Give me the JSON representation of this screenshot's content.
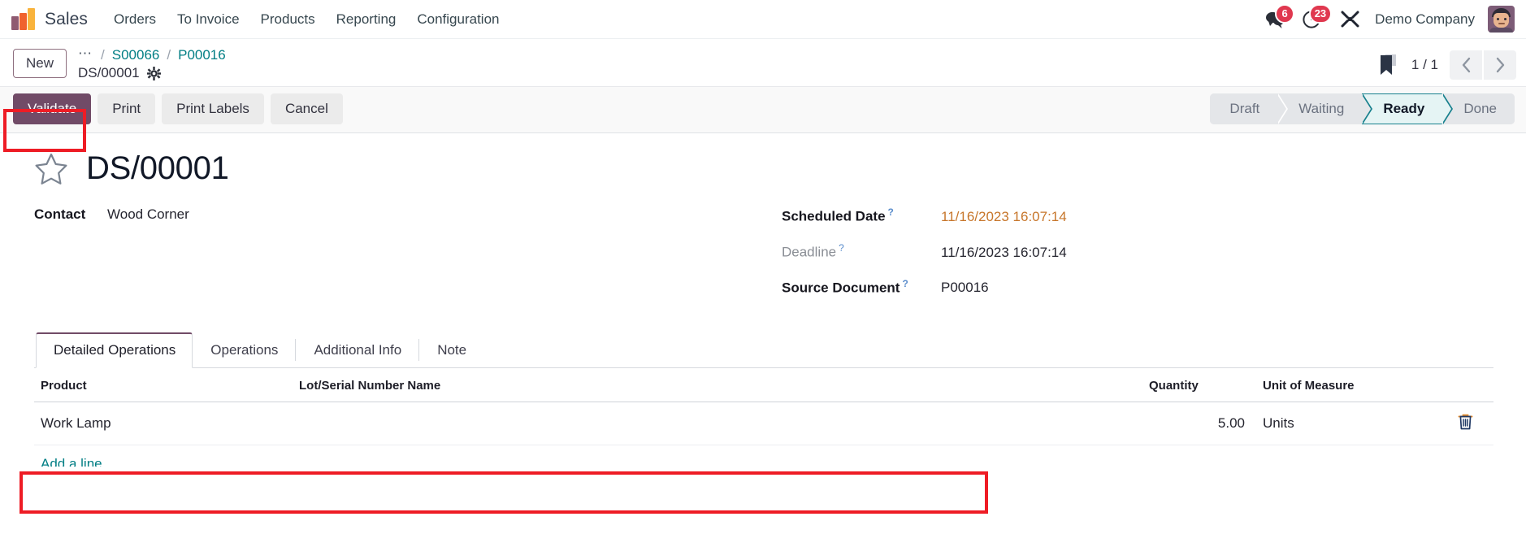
{
  "navbar": {
    "logo_icon": "odoo-bars-logo",
    "brand": "Sales",
    "menu_items": [
      {
        "label": "Orders"
      },
      {
        "label": "To Invoice"
      },
      {
        "label": "Products"
      },
      {
        "label": "Reporting"
      },
      {
        "label": "Configuration"
      }
    ],
    "messages": {
      "icon": "chat-bubble-icon",
      "count": "6"
    },
    "activities": {
      "icon": "clock-icon",
      "count": "23"
    },
    "debug": {
      "icon": "wrench-tools-icon"
    },
    "company": "Demo Company",
    "avatar_icon": "user-avatar"
  },
  "control_panel": {
    "new_button": "New",
    "breadcrumb": {
      "overflow_icon": "ellipsis-icon",
      "separator": "/",
      "items": [
        {
          "label": "S00066"
        },
        {
          "label": "P00016"
        }
      ],
      "current": "DS/00001",
      "settings_icon": "gear-icon"
    },
    "bookmark_icon": "bookmark-icon",
    "pager": {
      "value": "1 / 1",
      "prev_icon": "chevron-left-icon",
      "next_icon": "chevron-right-icon"
    }
  },
  "action_bar": {
    "buttons": [
      {
        "label": "Validate",
        "style": "primary"
      },
      {
        "label": "Print",
        "style": "secondary"
      },
      {
        "label": "Print Labels",
        "style": "secondary"
      },
      {
        "label": "Cancel",
        "style": "secondary"
      }
    ],
    "status_steps": [
      {
        "label": "Draft",
        "active": false
      },
      {
        "label": "Waiting",
        "active": false
      },
      {
        "label": "Ready",
        "active": true
      },
      {
        "label": "Done",
        "active": false
      }
    ]
  },
  "record": {
    "favorite_icon": "star-outline-icon",
    "title": "DS/00001",
    "fields_left": [
      {
        "label": "Contact",
        "value": "Wood Corner"
      }
    ],
    "fields_right": [
      {
        "label": "Scheduled Date",
        "help": "?",
        "value": "11/16/2023 16:07:14",
        "warn": true,
        "muted_label": false
      },
      {
        "label": "Deadline",
        "help": "?",
        "value": "11/16/2023 16:07:14",
        "warn": false,
        "muted_label": true
      },
      {
        "label": "Source Document",
        "help": "?",
        "value": "P00016",
        "warn": false,
        "muted_label": false
      }
    ]
  },
  "notebook": {
    "tabs": [
      {
        "label": "Detailed Operations",
        "active": true
      },
      {
        "label": "Operations",
        "active": false
      },
      {
        "label": "Additional Info",
        "active": false
      },
      {
        "label": "Note",
        "active": false
      }
    ],
    "table": {
      "columns": [
        "Product",
        "Lot/Serial Number Name",
        "Quantity",
        "Unit of Measure"
      ],
      "rows": [
        {
          "product": "Work Lamp",
          "lot": "",
          "quantity": "5.00",
          "uom": "Units",
          "delete_icon": "trash-icon"
        }
      ],
      "add_line": "Add a line"
    }
  },
  "colors": {
    "primary": "#714b67",
    "link": "#017e84",
    "warning": "#c7762b",
    "badge": "#e0384f",
    "annotation": "#ee1c25",
    "status_active": "#17808d"
  }
}
